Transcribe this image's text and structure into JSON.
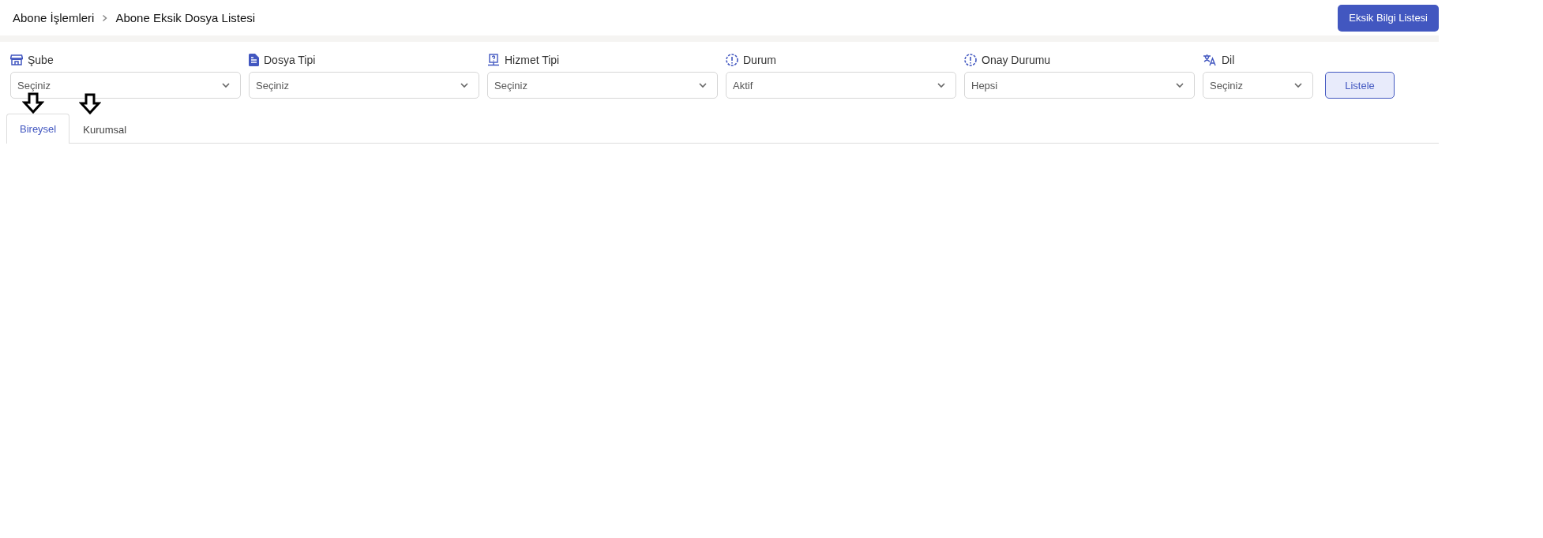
{
  "breadcrumb": [
    "Abone İşlemleri",
    "Abone Eksik Dosya Listesi"
  ],
  "header_button": "Eksik Bilgi Listesi",
  "filters": [
    {
      "kind": "store",
      "label": "Şube",
      "value": "Seçiniz"
    },
    {
      "kind": "document",
      "label": "Dosya Tipi",
      "value": "Seçiniz"
    },
    {
      "kind": "monitor",
      "label": "Hizmet Tipi",
      "value": "Seçiniz"
    },
    {
      "kind": "alert",
      "label": "Durum",
      "value": "Aktif"
    },
    {
      "kind": "alert",
      "label": "Onay Durumu",
      "value": "Hepsi"
    },
    {
      "kind": "translate",
      "label": "Dil",
      "value": "Seçiniz"
    }
  ],
  "list_button": "Listele",
  "tabs": [
    {
      "label": "Bireysel",
      "selected": true
    },
    {
      "label": "Kurumsal",
      "selected": false
    }
  ]
}
